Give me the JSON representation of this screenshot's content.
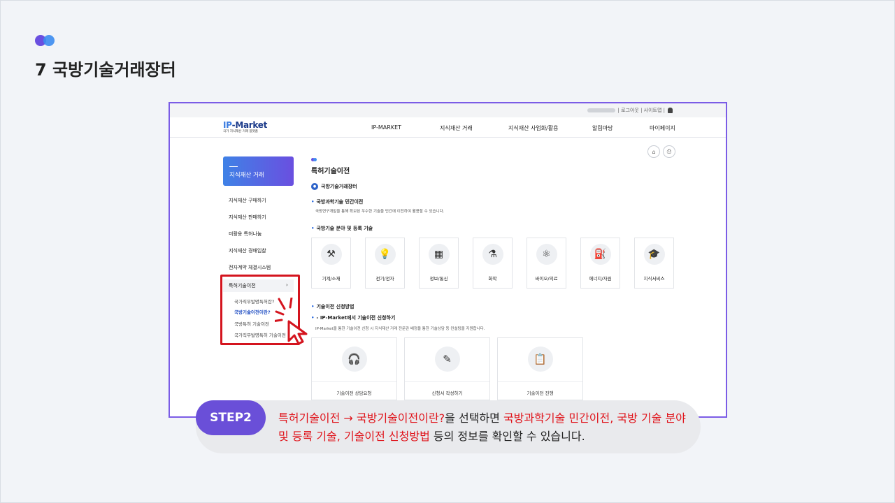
{
  "slide": {
    "title": "7 국방기술거래장터"
  },
  "site": {
    "topbar": {
      "links": "| 로그아웃 | 사이트맵 |"
    },
    "logo": {
      "main_a": "IP",
      "main_b": "-Market",
      "sub": "국가 지식재산 거래 플랫폼"
    },
    "gnb": [
      "IP-MARKET",
      "지식재산 거래",
      "지식재산 사업화/활용",
      "알림마당",
      "마이페이지"
    ],
    "lnb": {
      "title": "지식재산 거래",
      "items": [
        "지식재산 구매하기",
        "지식재산 판매하기",
        "미활용 특허나눔",
        "지식재산 경매입찰",
        "전자계약 체결시스템",
        "특허기술이전"
      ],
      "chevron": "›",
      "subitems": [
        "국가직무발명특허란?",
        "국방기술이전이란?",
        "국방특허 기술이전",
        "국가직무발명특허 기술이전"
      ]
    },
    "content": {
      "page_title": "특허기술이전",
      "brand": "국방기술거래장터",
      "sec1_title": "국방과학기술 민간이전",
      "sec1_desc": "국방연구개발을 통해 확보된 우수한 기술을 민간에 이전하여 활용할 수 있습니다.",
      "sec2_title": "국방기술 분야 및 등록 기술",
      "fields": [
        {
          "label": "기계/소재",
          "icon": "tools-icon",
          "glyph": "⚒"
        },
        {
          "label": "전기/전자",
          "icon": "lightbulb-icon",
          "glyph": "💡"
        },
        {
          "label": "정보/통신",
          "icon": "circuit-icon",
          "glyph": "▦"
        },
        {
          "label": "화학",
          "icon": "test-tubes-icon",
          "glyph": "⚗"
        },
        {
          "label": "바이오/의료",
          "icon": "atom-icon",
          "glyph": "⚛"
        },
        {
          "label": "에너지/자원",
          "icon": "barrel-icon",
          "glyph": "⛽"
        },
        {
          "label": "지식서비스",
          "icon": "graduation-cap-icon",
          "glyph": "🎓"
        }
      ],
      "sec3_title": "기술이전 신청방법",
      "sec3_sub": "- IP-Market에서 기술이전 신청하기",
      "sec3_desc": "IP-Market을 통한 기술이전 신청 시 지식재산 거래 전문관 배정을 통한 기술상담 등 컨설팅을 지원합니다.",
      "steps": [
        {
          "label": "기술이전 상담요청",
          "icon": "headset-icon",
          "glyph": "🎧"
        },
        {
          "label": "신청서 작성하기",
          "icon": "form-pen-icon",
          "glyph": "✎"
        },
        {
          "label": "기술이전 진행",
          "icon": "clipboard-icon",
          "glyph": "📋"
        }
      ]
    }
  },
  "caption": {
    "step": "STEP2",
    "p1": "특허기술이전 → 국방기술이전이란?",
    "p2": "을 선택하면 ",
    "p3": "국방과학기술 민간이전, 국방 기술 분야 및 등록 기술, 기술이전 신청방법",
    "p4": " 등의 정보를 확인할 수 있습니다."
  },
  "colors": {
    "accent": "#6a4fd8",
    "highlight": "#e0141b",
    "frame": "#7b5ce6"
  }
}
